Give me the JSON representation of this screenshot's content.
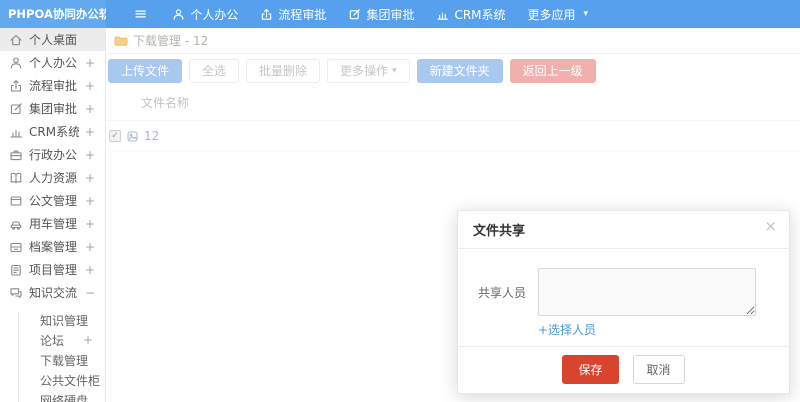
{
  "navbar": {
    "logo": "PHPOA协同办公软件",
    "menu": [
      {
        "label": "个人办公",
        "icon": "user-icon"
      },
      {
        "label": "流程审批",
        "icon": "flow-icon"
      },
      {
        "label": "集团审批",
        "icon": "edit-icon"
      },
      {
        "label": "CRM系统",
        "icon": "chart-icon"
      },
      {
        "label": "更多应用",
        "icon": "caret-down-icon"
      }
    ]
  },
  "icons": {
    "hamburger": "≡",
    "caret_down": "▾",
    "close": "×",
    "check": "✓"
  },
  "sidebar": {
    "items": [
      {
        "label": "个人桌面",
        "icon": "home-icon",
        "expander": "",
        "active": true
      },
      {
        "label": "个人办公",
        "icon": "user-icon",
        "expander": "+"
      },
      {
        "label": "流程审批",
        "icon": "flow-icon",
        "expander": "+"
      },
      {
        "label": "集团审批",
        "icon": "edit-icon",
        "expander": "+"
      },
      {
        "label": "CRM系统",
        "icon": "chart-icon",
        "expander": "+"
      },
      {
        "label": "行政办公",
        "icon": "briefcase-icon",
        "expander": "+"
      },
      {
        "label": "人力资源",
        "icon": "book-icon",
        "expander": "+"
      },
      {
        "label": "公文管理",
        "icon": "document-icon",
        "expander": "+"
      },
      {
        "label": "用车管理",
        "icon": "car-icon",
        "expander": "+"
      },
      {
        "label": "档案管理",
        "icon": "archive-icon",
        "expander": "+"
      },
      {
        "label": "项目管理",
        "icon": "project-icon",
        "expander": "+"
      },
      {
        "label": "知识交流",
        "icon": "chat-icon",
        "expander": "−",
        "expanded": true
      }
    ],
    "subitems": [
      {
        "label": "知识管理",
        "expander": ""
      },
      {
        "label": "论坛",
        "expander": "+"
      },
      {
        "label": "下载管理",
        "expander": ""
      },
      {
        "label": "公共文件柜",
        "expander": ""
      },
      {
        "label": "网络硬盘",
        "expander": ""
      }
    ]
  },
  "content": {
    "breadcrumb": "下载管理 - 12",
    "toolbar": {
      "upload": "上传文件",
      "select_all": "全选",
      "batch_delete": "批量删除",
      "more_ops": "更多操作",
      "new_folder": "新建文件夹",
      "go_back": "返回上一级"
    },
    "table": {
      "name_header": "文件名称",
      "rows": [
        {
          "name": "12",
          "checked": true
        }
      ]
    }
  },
  "modal": {
    "title": "文件共享",
    "field_label": "共享人员",
    "textarea_value": "",
    "select_link": "+选择人员",
    "save": "保存",
    "cancel": "取消"
  },
  "colors": {
    "navbar_bg": "#57a0ee",
    "logo_bg": "#63a9f0",
    "primary_muted": "#a9c8ee",
    "danger_muted": "#f0b0ae",
    "danger": "#d9442f",
    "link": "#4a9ad5",
    "folder_icon": "#f7cf8b"
  }
}
